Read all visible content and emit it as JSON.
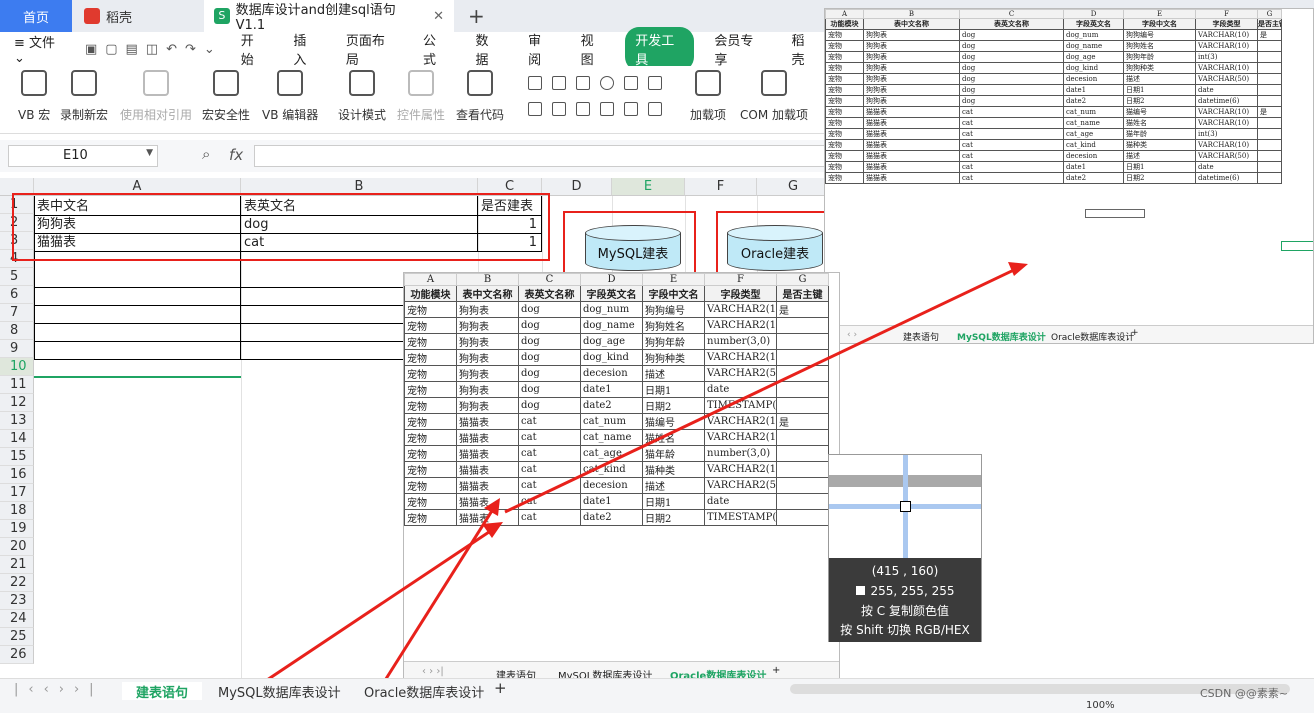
{
  "tabs": {
    "home": "首页",
    "daoke": "稻壳",
    "doc": "数据库设计and创建sql语句V1.1"
  },
  "menu": [
    "文件",
    "开始",
    "插入",
    "页面布局",
    "公式",
    "数据",
    "审阅",
    "视图",
    "开发工具",
    "会员专享",
    "稻壳"
  ],
  "ribbon": [
    "VB 宏",
    "录制新宏",
    "使用相对引用",
    "宏安全性",
    "VB 编辑器",
    "设计模式",
    "控件属性",
    "查看代码",
    "加载项",
    "COM 加载项"
  ],
  "namebox": "E10",
  "fx": "fx",
  "columns": [
    "A",
    "B",
    "C",
    "D",
    "E",
    "F",
    "G"
  ],
  "rows": [
    "1",
    "2",
    "3",
    "4",
    "5",
    "6",
    "7",
    "8",
    "9",
    "10",
    "11",
    "12",
    "13",
    "14",
    "15",
    "16",
    "17",
    "18",
    "19",
    "20",
    "21",
    "22",
    "23",
    "24",
    "25",
    "26"
  ],
  "sheet": {
    "header": [
      "表中文名",
      "表英文名",
      "是否建表"
    ],
    "rows": [
      [
        "狗狗表",
        "dog",
        "1"
      ],
      [
        "猫猫表",
        "cat",
        "1"
      ]
    ]
  },
  "buttons": {
    "mysql": "MySQL建表",
    "oracle": "Oracle建表"
  },
  "design": {
    "cols": [
      "A",
      "B",
      "C",
      "D",
      "E",
      "F",
      "G"
    ],
    "header": [
      "功能模块",
      "表中文名称",
      "表英文名称",
      "字段英文名",
      "字段中文名",
      "字段类型",
      "是否主键"
    ],
    "oracle_rows": [
      [
        "宠物",
        "狗狗表",
        "dog",
        "dog_num",
        "狗狗编号",
        "VARCHAR2(10)",
        "是"
      ],
      [
        "宠物",
        "狗狗表",
        "dog",
        "dog_name",
        "狗狗姓名",
        "VARCHAR2(10)",
        ""
      ],
      [
        "宠物",
        "狗狗表",
        "dog",
        "dog_age",
        "狗狗年龄",
        "number(3,0)",
        ""
      ],
      [
        "宠物",
        "狗狗表",
        "dog",
        "dog_kind",
        "狗狗种类",
        "VARCHAR2(10)",
        ""
      ],
      [
        "宠物",
        "狗狗表",
        "dog",
        "decesion",
        "描述",
        "VARCHAR2(50)",
        ""
      ],
      [
        "宠物",
        "狗狗表",
        "dog",
        "date1",
        "日期1",
        "date",
        ""
      ],
      [
        "宠物",
        "狗狗表",
        "dog",
        "date2",
        "日期2",
        "TIMESTAMP(6)",
        ""
      ],
      [
        "宠物",
        "猫猫表",
        "cat",
        "cat_num",
        "猫编号",
        "VARCHAR2(10)",
        "是"
      ],
      [
        "宠物",
        "猫猫表",
        "cat",
        "cat_name",
        "猫姓名",
        "VARCHAR2(10)",
        ""
      ],
      [
        "宠物",
        "猫猫表",
        "cat",
        "cat_age",
        "猫年龄",
        "number(3,0)",
        ""
      ],
      [
        "宠物",
        "猫猫表",
        "cat",
        "cat_kind",
        "猫种类",
        "VARCHAR2(10)",
        ""
      ],
      [
        "宠物",
        "猫猫表",
        "cat",
        "decesion",
        "描述",
        "VARCHAR2(50)",
        ""
      ],
      [
        "宠物",
        "猫猫表",
        "cat",
        "date1",
        "日期1",
        "date",
        ""
      ],
      [
        "宠物",
        "猫猫表",
        "cat",
        "date2",
        "日期2",
        "TIMESTAMP(6)",
        ""
      ]
    ],
    "mysql_rows": [
      [
        "宠物",
        "狗狗表",
        "dog",
        "dog_num",
        "狗狗编号",
        "VARCHAR(10)",
        "是"
      ],
      [
        "宠物",
        "狗狗表",
        "dog",
        "dog_name",
        "狗狗姓名",
        "VARCHAR(10)",
        ""
      ],
      [
        "宠物",
        "狗狗表",
        "dog",
        "dog_age",
        "狗狗年龄",
        "int(3)",
        ""
      ],
      [
        "宠物",
        "狗狗表",
        "dog",
        "dog_kind",
        "狗狗种类",
        "VARCHAR(10)",
        ""
      ],
      [
        "宠物",
        "狗狗表",
        "dog",
        "decesion",
        "描述",
        "VARCHAR(50)",
        ""
      ],
      [
        "宠物",
        "狗狗表",
        "dog",
        "date1",
        "日期1",
        "date",
        ""
      ],
      [
        "宠物",
        "狗狗表",
        "dog",
        "date2",
        "日期2",
        "datetime(6)",
        ""
      ],
      [
        "宠物",
        "猫猫表",
        "cat",
        "cat_num",
        "猫编号",
        "VARCHAR(10)",
        "是"
      ],
      [
        "宠物",
        "猫猫表",
        "cat",
        "cat_name",
        "猫姓名",
        "VARCHAR(10)",
        ""
      ],
      [
        "宠物",
        "猫猫表",
        "cat",
        "cat_age",
        "猫年龄",
        "int(3)",
        ""
      ],
      [
        "宠物",
        "猫猫表",
        "cat",
        "cat_kind",
        "猫种类",
        "VARCHAR(10)",
        ""
      ],
      [
        "宠物",
        "猫猫表",
        "cat",
        "decesion",
        "描述",
        "VARCHAR(50)",
        ""
      ],
      [
        "宠物",
        "猫猫表",
        "cat",
        "date1",
        "日期1",
        "date",
        ""
      ],
      [
        "宠物",
        "猫猫表",
        "cat",
        "date2",
        "日期2",
        "datetime(6)",
        ""
      ]
    ]
  },
  "sheet_tabs": [
    "建表语句",
    "MySQL数据库表设计",
    "Oracle数据库表设计"
  ],
  "picker": {
    "coord": "(415 , 160)",
    "rgb": "255, 255, 255",
    "hint1": "按 C 复制颜色值",
    "hint2": "按 Shift 切换 RGB/HEX"
  },
  "watermark": "CSDN @@素素~",
  "zoom": "100%",
  "colors": {
    "accent": "#1fa463",
    "red": "#e8211b",
    "tab_blue": "#3d7cf0"
  }
}
